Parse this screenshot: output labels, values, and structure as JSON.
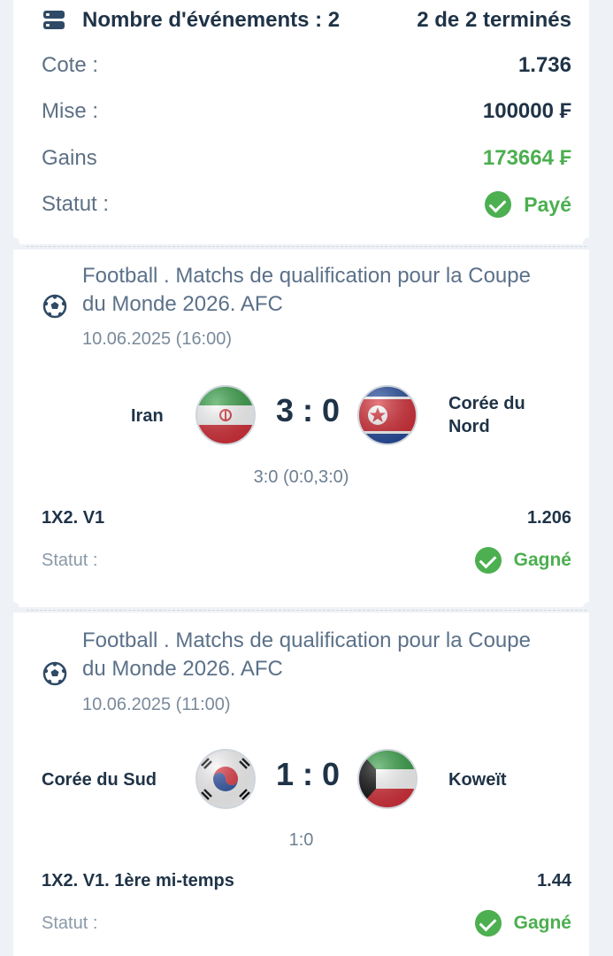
{
  "summary": {
    "events_label": "Nombre d'événements : 2",
    "completed": "2 de 2 terminés",
    "odds_label": "Cote :",
    "odds_value": "1.736",
    "stake_label": "Mise :",
    "stake_value": "100000 ₣",
    "winnings_label": "Gains",
    "winnings_value": "173664 ₣",
    "status_label": "Statut :",
    "status_value": "Payé"
  },
  "events": [
    {
      "title": "Football . Matchs de qualification pour la Coupe du Monde 2026. AFC",
      "date": "10.06.2025 (16:00)",
      "home_team": "Iran",
      "away_team": "Corée du Nord",
      "score": "3 : 0",
      "score_detail": "3:0 (0:0,3:0)",
      "bet": "1X2. V1",
      "odds": "1.206",
      "status_label": "Statut :",
      "status_value": "Gagné",
      "home_flag_icon": "iran-flag-icon",
      "away_flag_icon": "north-korea-flag-icon"
    },
    {
      "title": "Football . Matchs de qualification pour la Coupe du Monde 2026. AFC",
      "date": "10.06.2025 (11:00)",
      "home_team": "Corée du Sud",
      "away_team": "Koweït",
      "score": "1 : 0",
      "score_detail": "1:0",
      "bet": "1X2. V1. 1ère mi-temps",
      "odds": "1.44",
      "status_label": "Statut :",
      "status_value": "Gagné",
      "home_flag_icon": "south-korea-flag-icon",
      "away_flag_icon": "kuwait-flag-icon"
    }
  ],
  "colors": {
    "accent_green": "#4caf50",
    "text_dark": "#1f3347",
    "text_muted": "#5d7084",
    "background": "#eef1f5"
  },
  "icons": {
    "summary_icon": "toggle-list-icon",
    "sport_icon": "football-icon",
    "status_icon": "check-circle-icon"
  }
}
